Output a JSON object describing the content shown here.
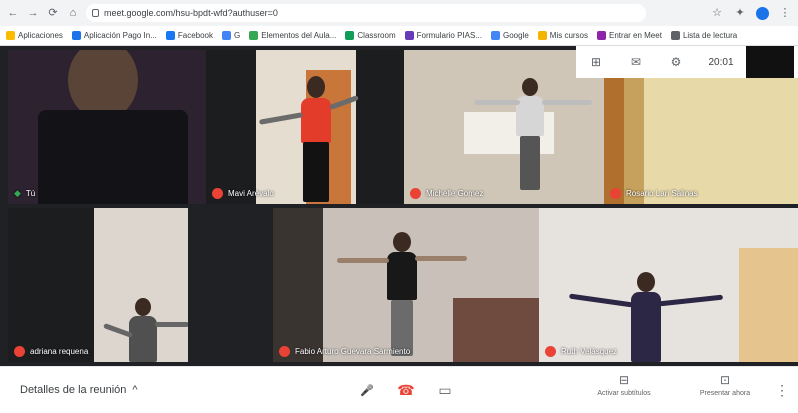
{
  "browser": {
    "back": "←",
    "forward": "→",
    "reload": "⟳",
    "home": "⌂",
    "url": "meet.google.com/hsu-bpdt-wfd?authuser=0",
    "menu": "⋮"
  },
  "bookmarks": [
    {
      "label": "Aplicaciones",
      "color": "#fbbc04"
    },
    {
      "label": "Aplicación Pago In...",
      "color": "#1a73e8"
    },
    {
      "label": "Facebook",
      "color": "#1877f2"
    },
    {
      "label": "G",
      "color": "#4285f4"
    },
    {
      "label": "Elementos del Aula...",
      "color": "#34a853"
    },
    {
      "label": "Classroom",
      "color": "#0f9d58"
    },
    {
      "label": "Formulario PIAS...",
      "color": "#673ab7"
    },
    {
      "label": "Google",
      "color": "#4285f4"
    },
    {
      "label": "Mis cursos",
      "color": "#f4b400"
    },
    {
      "label": "Entrar en Meet",
      "color": "#8e24aa"
    },
    {
      "label": "Lista de lectura",
      "color": "#5f6368"
    }
  ],
  "meet_top": {
    "people": "⊞",
    "chat": "✉",
    "activities": "⚙",
    "clock": "20:01"
  },
  "participants": [
    {
      "name": "Tú",
      "muted": false
    },
    {
      "name": "Mavi Arévalo",
      "muted": true
    },
    {
      "name": "Michelle Gomez",
      "muted": true
    },
    {
      "name": "Rosario Lari Salinas",
      "muted": true
    },
    {
      "name": "adriana requena",
      "muted": true
    },
    {
      "name": "Fabio Arturo Guevara Sarmiento",
      "muted": true
    },
    {
      "name": "Ruth Velásquez",
      "muted": true
    }
  ],
  "bottom": {
    "details": "Detalles de la reunión",
    "details_chevron": "^",
    "mic": "🎤",
    "hangup": "☎",
    "camera": "▭",
    "captions_icon": "⊟",
    "captions_label": "Activar subtítulos",
    "present_icon": "⊡",
    "present_label": "Presentar ahora",
    "more": "⋮"
  },
  "colors": {
    "mute": "#ea4335",
    "hangup": "#ea4335",
    "stage": "#202124"
  }
}
